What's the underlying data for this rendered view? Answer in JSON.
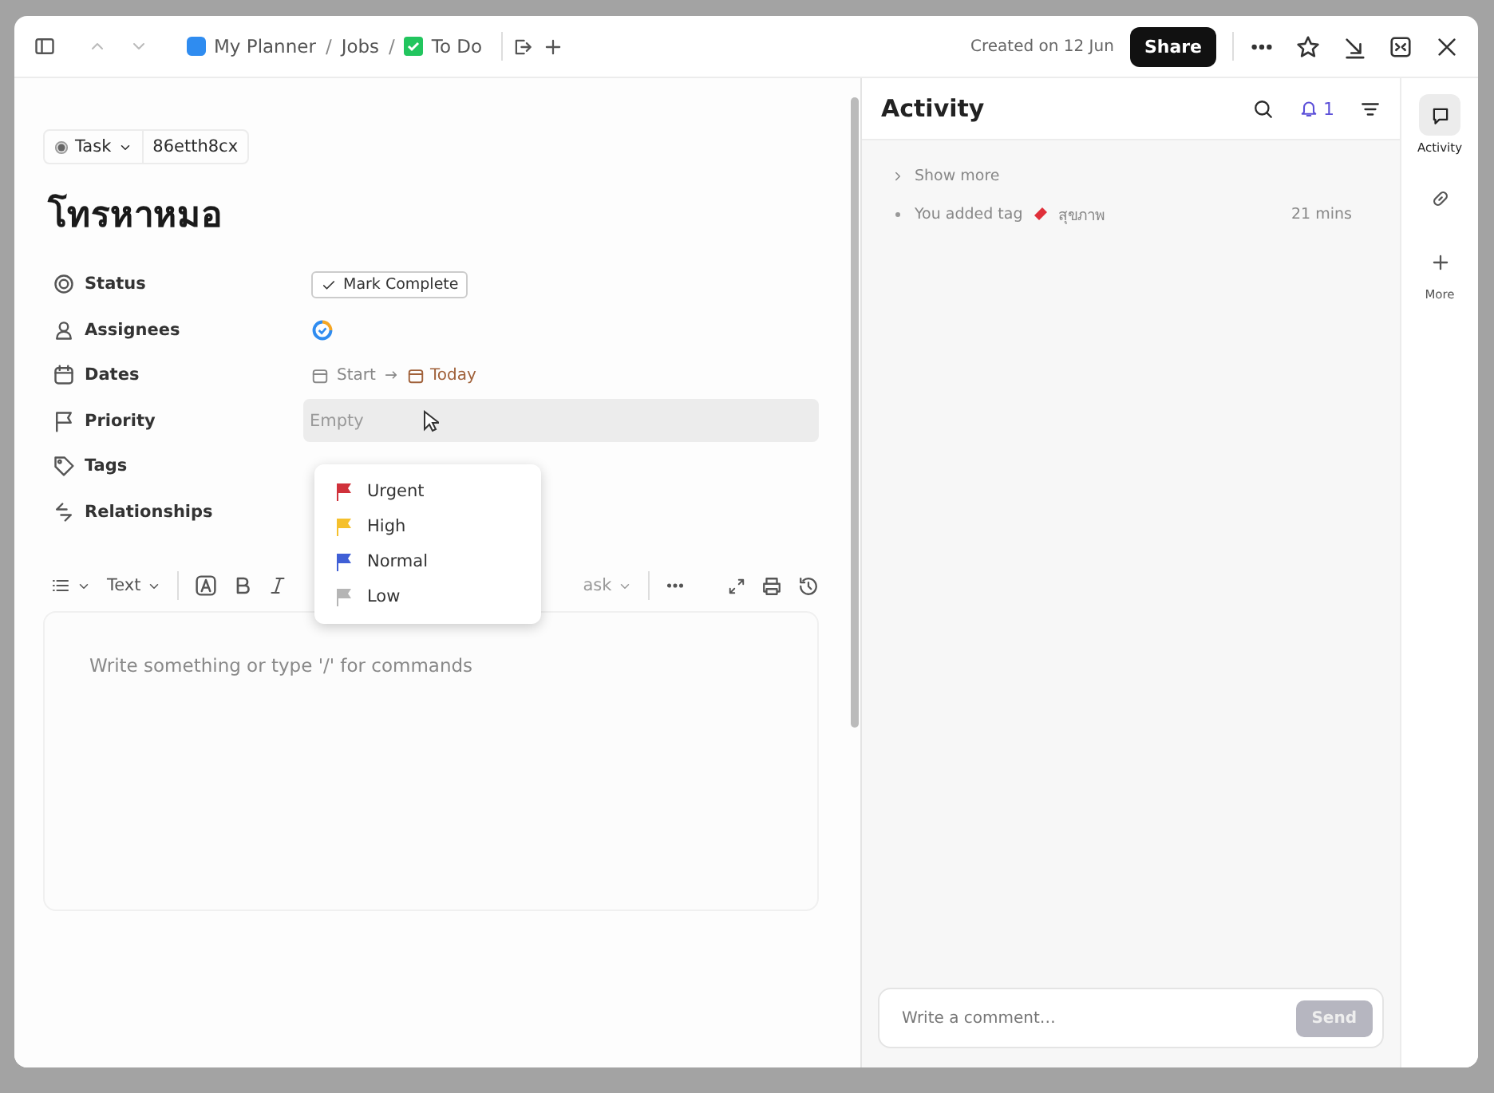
{
  "breadcrumbs": [
    {
      "label": "My Planner",
      "separator": "/"
    },
    {
      "label": "Jobs",
      "separator": "/"
    },
    {
      "label": "To Do"
    }
  ],
  "created": "Created on 12 Jun",
  "share": "Share",
  "task": {
    "type": "Task",
    "id": "86etth8cx",
    "title": "โทรหาหมอ"
  },
  "fields": [
    {
      "kind": "status",
      "label": "Status",
      "value": "Mark Complete"
    },
    {
      "kind": "assignees",
      "label": "Assignees"
    },
    {
      "kind": "dates",
      "label": "Dates",
      "start": "Start",
      "due": "Today"
    },
    {
      "kind": "priority",
      "label": "Priority",
      "value": "Empty"
    },
    {
      "kind": "tags",
      "label": "Tags"
    },
    {
      "kind": "relationships",
      "label": "Relationships"
    }
  ],
  "priority_menu": [
    {
      "label": "Urgent",
      "color": "#d0313b"
    },
    {
      "label": "High",
      "color": "#f5c02c"
    },
    {
      "label": "Normal",
      "color": "#3f5fd6"
    },
    {
      "label": "Low",
      "color": "#b5b5b5"
    }
  ],
  "toolbar": {
    "text_style": "Text",
    "hidden_item": "ask"
  },
  "editor": {
    "placeholder": "Write something or type '/' for commands"
  },
  "activity": {
    "title": "Activity",
    "notifications": "1",
    "show_more": "Show more",
    "items": [
      {
        "text": "You added tag",
        "tag": "สุขภาพ",
        "time": "21 mins"
      }
    ],
    "comment_placeholder": "Write a comment…",
    "send": "Send"
  },
  "rail": [
    {
      "label": "Activity",
      "selected": true
    },
    {
      "selected": false
    },
    {
      "label": "More",
      "selected": false
    }
  ]
}
